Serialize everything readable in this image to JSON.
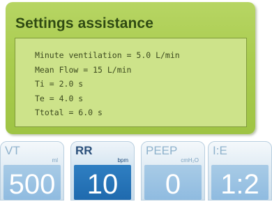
{
  "assistance": {
    "title": "Settings assistance",
    "lines": [
      "Minute ventilation = 5.0 L/min",
      "Mean Flow = 15 L/min",
      "Ti = 2.0 s",
      "Te = 4.0 s",
      "Ttotal = 6.0 s"
    ]
  },
  "parameters": [
    {
      "label": "VT",
      "unit": "ml",
      "value": "500",
      "selected": false
    },
    {
      "label": "RR",
      "unit": "bpm",
      "value": "10",
      "selected": true
    },
    {
      "label": "PEEP",
      "unit": "cmH₂O",
      "value": "0",
      "selected": false
    },
    {
      "label": "I:E",
      "unit": "",
      "value": "1:2",
      "selected": false
    }
  ],
  "colors": {
    "panel_green": "#a9cc4e",
    "selected_blue": "#1f6aae",
    "value_blue": "#8fbbe0"
  }
}
